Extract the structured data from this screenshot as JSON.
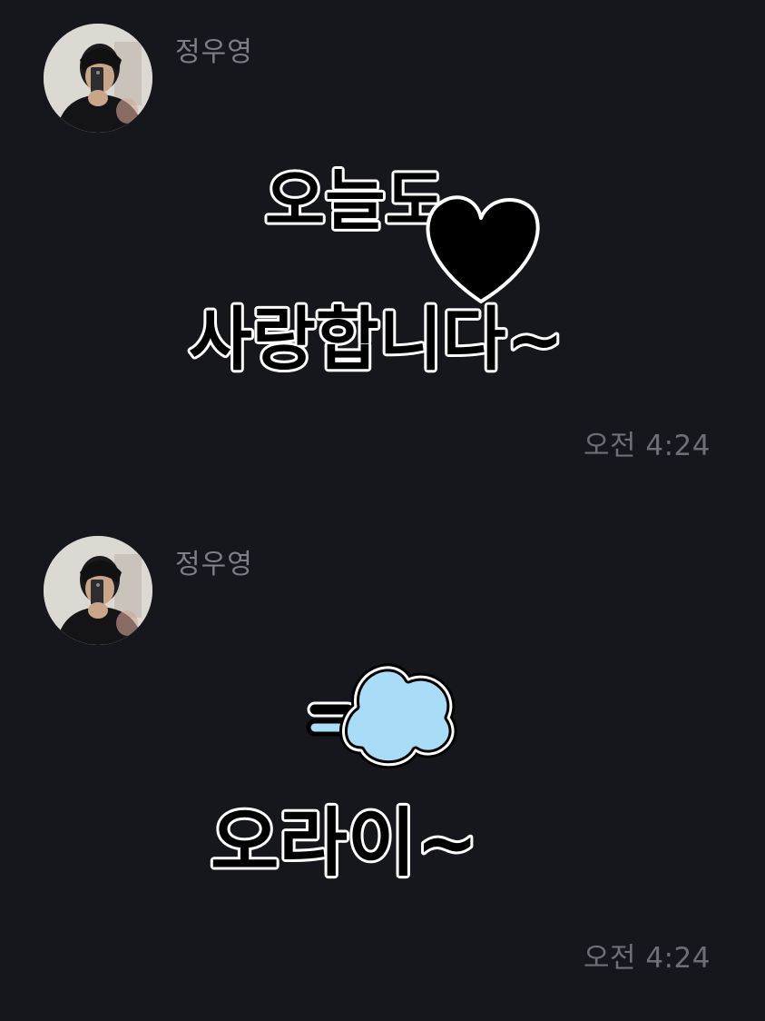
{
  "messages": [
    {
      "sender": "정우영",
      "sticker": {
        "line1": "오늘도",
        "line2": "사랑합니다~",
        "icon": "heart-icon"
      },
      "time": "오전 4:24"
    },
    {
      "sender": "정우영",
      "sticker": {
        "line1": "오라이~",
        "icon": "puff-cloud-icon"
      },
      "time": "오전 4:24"
    }
  ],
  "colors": {
    "background": "#16171c",
    "sender_text": "#7d7f86",
    "time_text": "#6d6f76",
    "cloud": "#a9dcf6"
  }
}
